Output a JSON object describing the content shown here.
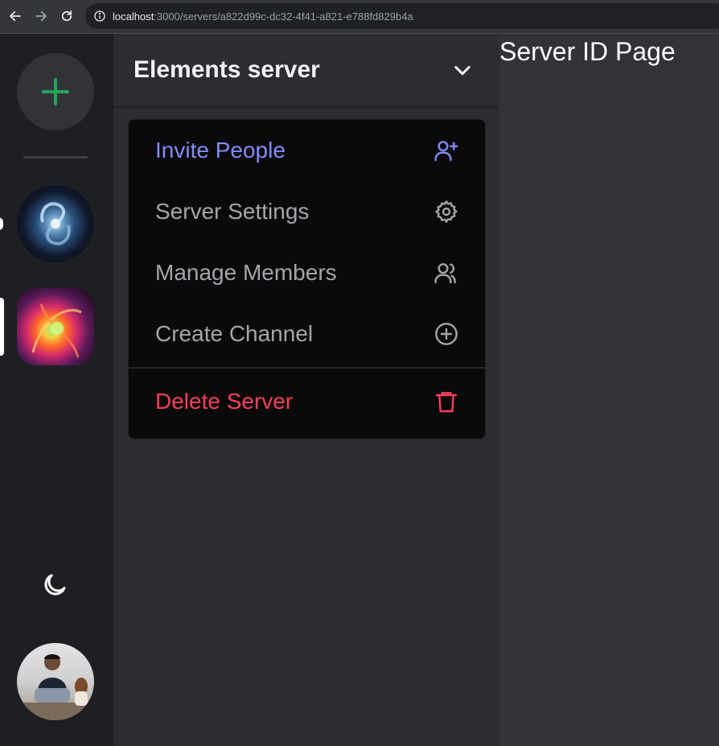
{
  "browser": {
    "url_host": "localhost",
    "url_path": ":3000/servers/a822d99c-dc32-4f41-a821-e788fd829b4a"
  },
  "rail": {
    "icons": [
      "plus-icon",
      "moon-icon"
    ],
    "accent": "#23a55a"
  },
  "server": {
    "name": "Elements server"
  },
  "menu": {
    "items": [
      {
        "label": "Invite People",
        "icon": "user-plus-icon",
        "color": "#818cf8"
      },
      {
        "label": "Server Settings",
        "icon": "gear-icon",
        "color": "#a3a6aa"
      },
      {
        "label": "Manage Members",
        "icon": "users-icon",
        "color": "#a3a6aa"
      },
      {
        "label": "Create Channel",
        "icon": "plus-circle-icon",
        "color": "#a3a6aa"
      },
      {
        "label": "Delete Server",
        "icon": "trash-icon",
        "color": "#f43f5e"
      }
    ]
  },
  "main": {
    "heading": "Server ID Page"
  }
}
